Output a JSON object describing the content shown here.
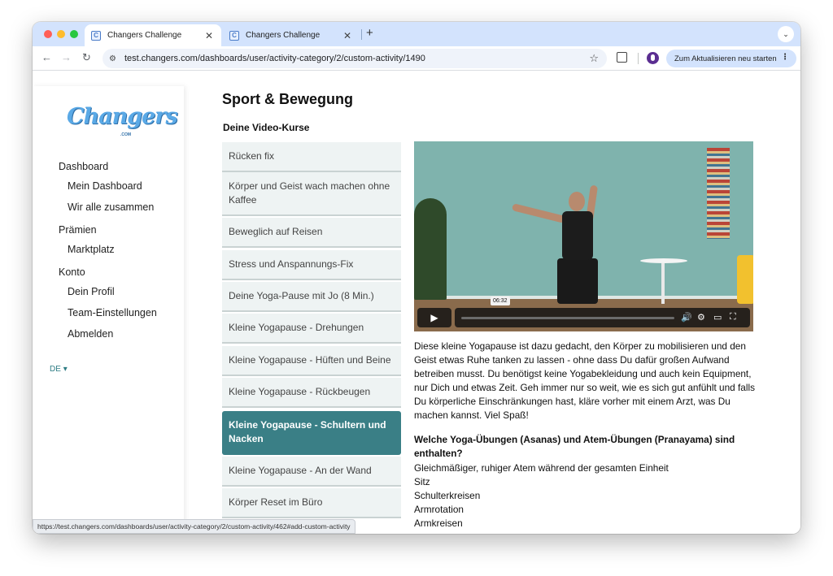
{
  "browser": {
    "tabs": [
      {
        "title": "Changers Challenge",
        "favicon_letter": "C"
      },
      {
        "title": "Changers Challenge",
        "favicon_letter": "C"
      }
    ],
    "url": "test.changers.com/dashboards/user/activity-category/2/custom-activity/1490",
    "update_button": "Zum Aktualisieren neu starten",
    "status_url": "https://test.changers.com/dashboards/user/activity-category/2/custom-activity/462#add-custom-activity"
  },
  "sidebar": {
    "logo_text": "Changers",
    "logo_sub": ".COM",
    "groups": [
      {
        "label": "Dashboard",
        "items": [
          "Mein Dashboard",
          "Wir alle zusammen"
        ]
      },
      {
        "label": "Prämien",
        "items": [
          "Marktplatz"
        ]
      },
      {
        "label": "Konto",
        "items": [
          "Dein Profil",
          "Team-Einstellungen",
          "Abmelden"
        ]
      }
    ],
    "language": "DE"
  },
  "main": {
    "title": "Sport & Bewegung",
    "section_title": "Deine Video-Kurse",
    "courses": [
      "Rücken fix",
      "Körper und Geist wach machen ohne Kaffee",
      "Beweglich auf Reisen",
      "Stress und Anspannungs-Fix",
      "Deine Yoga-Pause mit Jo (8 Min.)",
      "Kleine Yogapause - Drehungen",
      "Kleine Yogapause - Hüften und Beine",
      "Kleine Yogapause - Rückbeugen",
      "Kleine Yogapause - Schultern und Nacken",
      "Kleine Yogapause - An der Wand",
      "Körper Reset im Büro"
    ],
    "active_course_index": 8,
    "video": {
      "duration": "06:32",
      "progress_fraction": 0
    },
    "description": "Diese kleine Yogapause ist dazu gedacht, den Körper zu mobilisieren und den Geist etwas Ruhe tanken zu lassen - ohne dass Du dafür großen Aufwand betreiben musst. Du benötigst keine Yogabekleidung und auch kein Equipment, nur Dich und etwas Zeit. Geh immer nur so weit, wie es sich gut anfühlt und falls Du körperliche Einschränkungen hast, kläre vorher mit einem Arzt, was Du machen kannst. Viel Spaß!",
    "exercises_heading": "Welche Yoga-Übungen (Asanas) und Atem-Übungen (Pranayama) sind enthalten?",
    "exercises": [
      "Gleichmäßiger, ruhiger Atem während der gesamten Einheit",
      "Sitz",
      "Schulterkreisen",
      "Armrotation",
      "Armkreisen"
    ]
  },
  "colors": {
    "accent": "#3a7f86",
    "course_bg": "#eef3f3",
    "tab_strip": "#d3e3fd"
  }
}
